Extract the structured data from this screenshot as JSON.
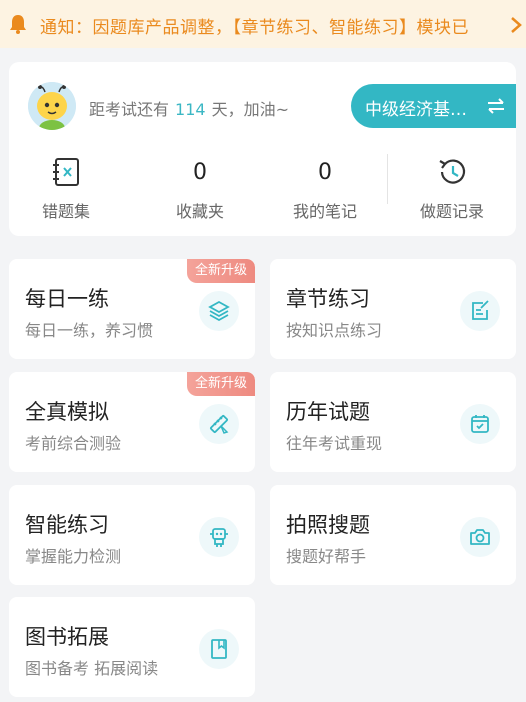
{
  "notice": {
    "text": "通知：因题库产品调整，【章节练习、智能练习】模块已",
    "color": "#ea8a1e"
  },
  "profile": {
    "countdown_prefix": "距考试还有",
    "days": "114",
    "countdown_suffix": "天，加油~",
    "exam_name": "中级经济基…",
    "stats": [
      {
        "label": "错题集",
        "icon": "wrong-book-icon"
      },
      {
        "value": "0",
        "label": "收藏夹"
      },
      {
        "value": "0",
        "label": "我的笔记"
      },
      {
        "label": "做题记录",
        "icon": "history-icon"
      }
    ]
  },
  "features": [
    {
      "title": "每日一练",
      "subtitle": "每日一练，养习惯",
      "badge": "全新升级",
      "icon": "layers-icon"
    },
    {
      "title": "章节练习",
      "subtitle": "按知识点练习",
      "icon": "edit-note-icon"
    },
    {
      "title": "全真模拟",
      "subtitle": "考前综合测验",
      "badge": "全新升级",
      "icon": "pen-ruler-icon"
    },
    {
      "title": "历年试题",
      "subtitle": "往年考试重现",
      "icon": "calendar-check-icon"
    },
    {
      "title": "智能练习",
      "subtitle": "掌握能力检测",
      "icon": "robot-icon"
    },
    {
      "title": "拍照搜题",
      "subtitle": "搜题好帮手",
      "icon": "camera-icon"
    },
    {
      "title": "图书拓展",
      "subtitle": "图书备考 拓展阅读",
      "icon": "book-icon"
    }
  ],
  "colors": {
    "accent": "#33b7c4",
    "badge": "#ee8a80",
    "notice_bg": "#fdf3e2"
  }
}
